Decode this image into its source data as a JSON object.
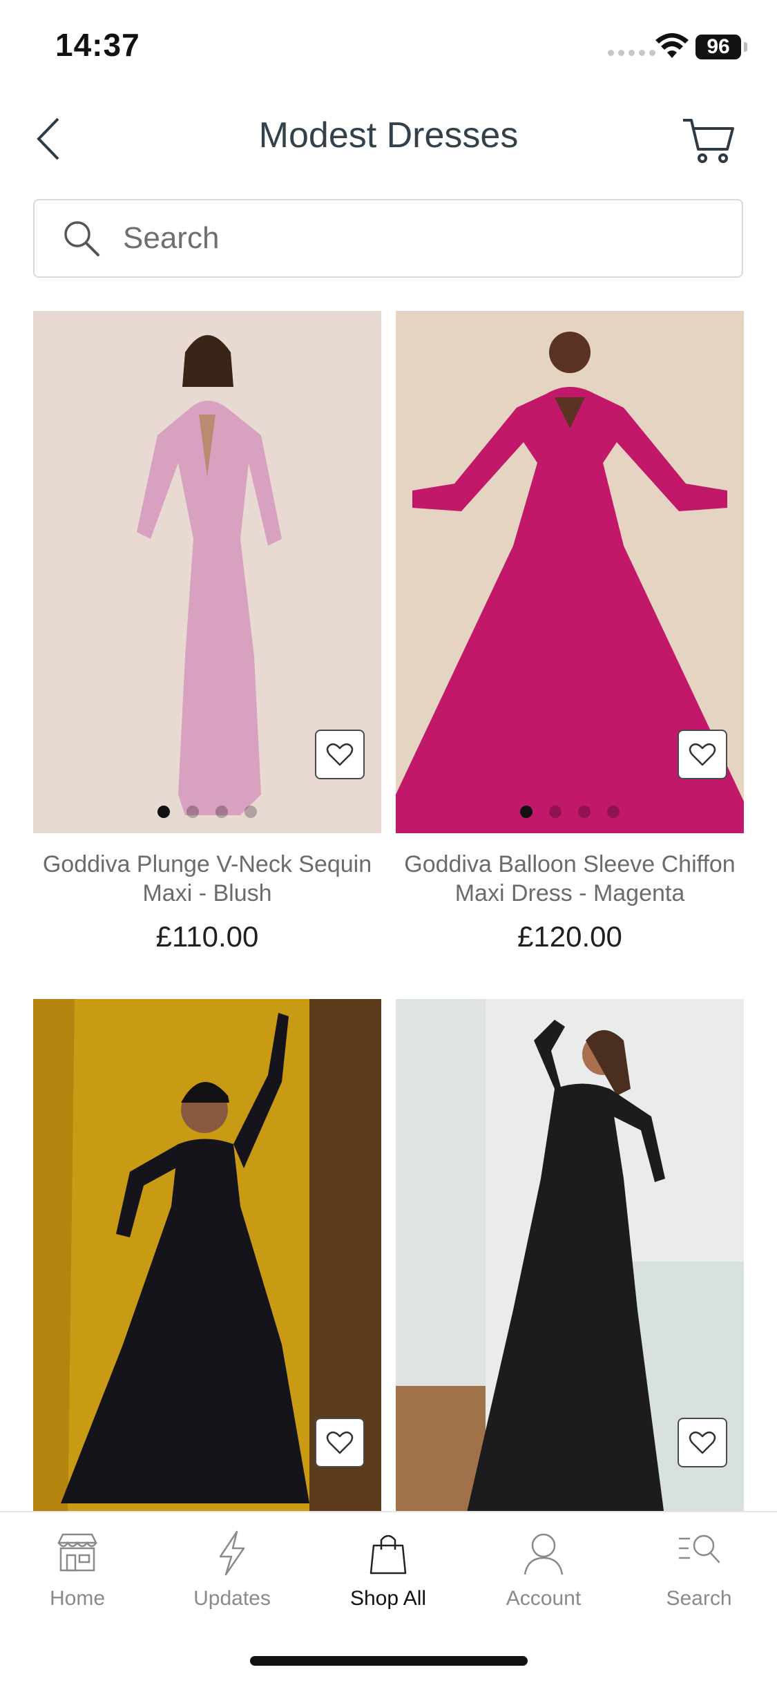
{
  "status_bar": {
    "time": "14:37",
    "battery": "96"
  },
  "header": {
    "title": "Modest Dresses"
  },
  "search": {
    "placeholder": "Search"
  },
  "products": [
    {
      "name": "Goddiva Plunge V-Neck Sequin Maxi - Blush",
      "price": "£110.00",
      "image_colors": {
        "bg": "#e6d8d2",
        "dress": "#d7a1bf"
      }
    },
    {
      "name": "Goddiva Balloon Sleeve Chiffon Maxi Dress - Magenta",
      "price": "£120.00",
      "image_colors": {
        "bg": "#e3d2c0",
        "dress": "#c1186a"
      }
    },
    {
      "name": "",
      "price": "",
      "image_colors": {
        "bg": "#c99a14",
        "dress": "#14141a"
      }
    },
    {
      "name": "",
      "price": "",
      "image_colors": {
        "bg": "#e8ebe9",
        "dress": "#1c1c1e"
      }
    }
  ],
  "tab_bar": {
    "tabs": [
      {
        "label": "Home",
        "icon": "storefront-icon"
      },
      {
        "label": "Updates",
        "icon": "lightning-icon"
      },
      {
        "label": "Shop All",
        "icon": "shopping-bag-icon"
      },
      {
        "label": "Account",
        "icon": "person-icon"
      },
      {
        "label": "Search",
        "icon": "search-list-icon"
      }
    ],
    "active": "Shop All"
  }
}
